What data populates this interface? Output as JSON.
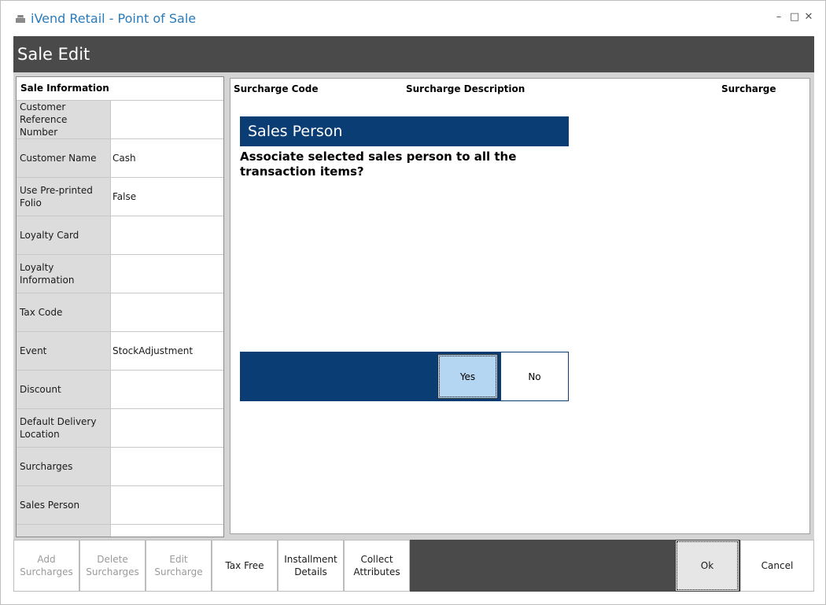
{
  "window": {
    "title": "iVend Retail - Point of Sale",
    "minimize_glyph": "–",
    "maximize_glyph": "□",
    "close_glyph": "✕"
  },
  "header": {
    "title": "Sale Edit"
  },
  "sale_information": {
    "heading": "Sale Information",
    "rows": [
      {
        "label": "Customer Reference Number",
        "value": ""
      },
      {
        "label": "Customer Name",
        "value": "Cash"
      },
      {
        "label": "Use Pre-printed Folio",
        "value": "False"
      },
      {
        "label": "Loyalty Card",
        "value": ""
      },
      {
        "label": "Loyalty Information",
        "value": ""
      },
      {
        "label": "Tax Code",
        "value": ""
      },
      {
        "label": "Event",
        "value": "StockAdjustment"
      },
      {
        "label": "Discount",
        "value": ""
      },
      {
        "label": "Default Delivery Location",
        "value": ""
      },
      {
        "label": "Surcharges",
        "value": ""
      },
      {
        "label": "Sales Person",
        "value": ""
      }
    ]
  },
  "surcharge_grid": {
    "columns": [
      "Surcharge Code",
      "Surcharge Description",
      "Surcharge"
    ]
  },
  "dialog": {
    "title": "Sales Person",
    "message": "Associate selected sales person to all the transaction items?",
    "yes_label": "Yes",
    "no_label": "No"
  },
  "footer": {
    "buttons": [
      {
        "label": "Add Surcharges",
        "enabled": false
      },
      {
        "label": "Delete Surcharges",
        "enabled": false
      },
      {
        "label": "Edit Surcharge",
        "enabled": false
      },
      {
        "label": "Tax Free",
        "enabled": true
      },
      {
        "label": "Installment Details",
        "enabled": true
      },
      {
        "label": "Collect Attributes",
        "enabled": true
      }
    ],
    "ok_label": "Ok",
    "cancel_label": "Cancel"
  },
  "colors": {
    "title_text": "#2b7bb9",
    "header_bar": "#4a4a4a",
    "dialog_blue": "#0a3d73",
    "yes_highlight": "#b4d6f2"
  }
}
